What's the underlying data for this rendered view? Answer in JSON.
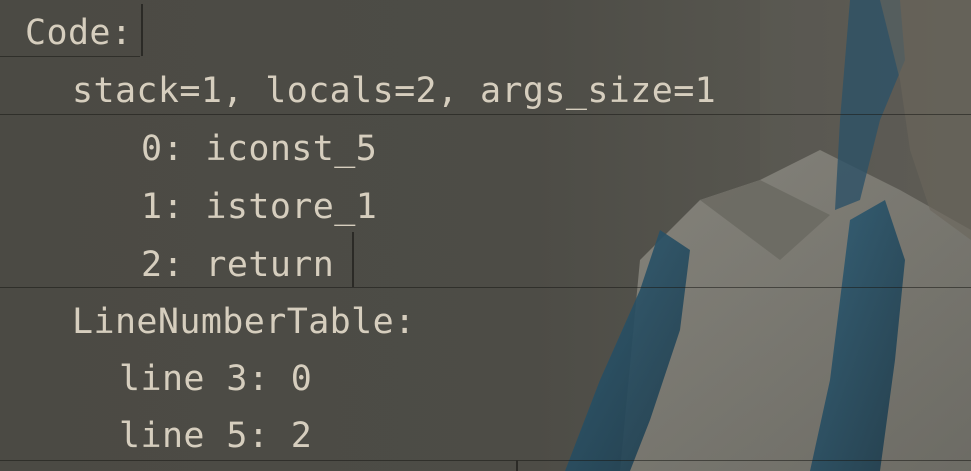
{
  "terminal": {
    "lines": [
      "Code:",
      "stack=1, locals=2, args_size=1",
      "0: iconst_5",
      "1: istore_1",
      "2: return",
      "LineNumberTable:",
      "line 3: 0",
      "line 5: 2"
    ],
    "colors": {
      "background": "#4c4b45",
      "text": "#d6cebe"
    }
  }
}
